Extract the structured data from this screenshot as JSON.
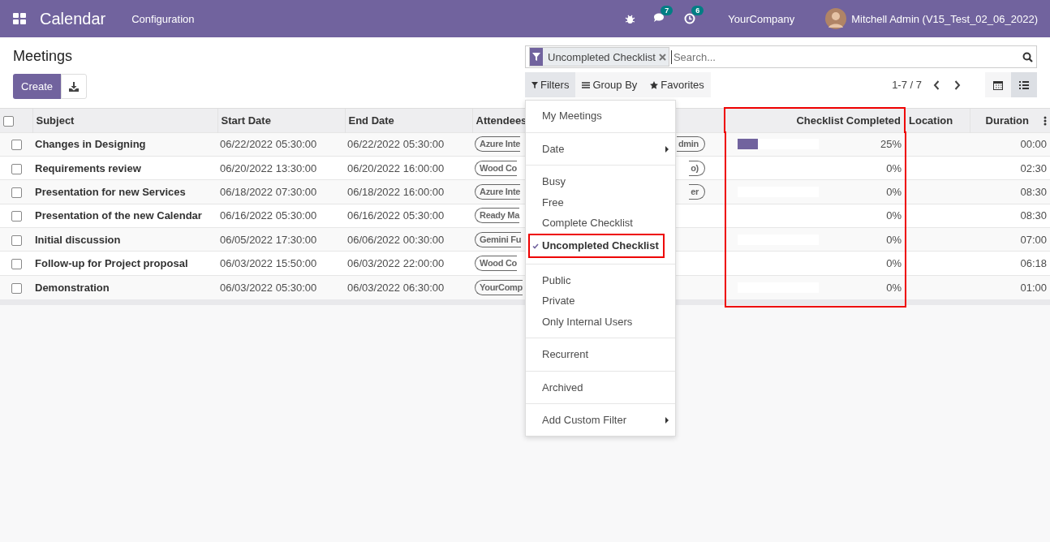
{
  "navbar": {
    "app_name": "Calendar",
    "menu": [
      "Configuration"
    ],
    "messages_count": "7",
    "activities_count": "6",
    "company": "YourCompany",
    "user": "Mitchell Admin (V15_Test_02_06_2022)"
  },
  "breadcrumb": "Meetings",
  "create_button": "Create",
  "search": {
    "facet": "Uncompleted Checklist",
    "placeholder": "Search..."
  },
  "search_panel": [
    {
      "kind": "filter",
      "label": "Filters",
      "selected": true
    },
    {
      "kind": "group",
      "label": "Group By",
      "selected": false
    },
    {
      "kind": "star",
      "label": "Favorites",
      "selected": false
    }
  ],
  "pager": "1-7 / 7",
  "views": [
    {
      "kind": "calendar",
      "selected": false
    },
    {
      "kind": "list",
      "selected": true
    }
  ],
  "filters_menu": [
    [
      {
        "label": "My Meetings",
        "checked": false,
        "submenu": false
      }
    ],
    [
      {
        "label": "Date",
        "checked": false,
        "submenu": true
      }
    ],
    [
      {
        "label": "Busy",
        "checked": false,
        "submenu": false
      },
      {
        "label": "Free",
        "checked": false,
        "submenu": false
      },
      {
        "label": "Complete Checklist",
        "checked": false,
        "submenu": false
      },
      {
        "label": "Uncompleted Checklist",
        "checked": true,
        "submenu": false
      }
    ],
    [
      {
        "label": "Public",
        "checked": false,
        "submenu": false
      },
      {
        "label": "Private",
        "checked": false,
        "submenu": false
      },
      {
        "label": "Only Internal Users",
        "checked": false,
        "submenu": false
      }
    ],
    [
      {
        "label": "Recurrent",
        "checked": false,
        "submenu": false
      }
    ],
    [
      {
        "label": "Archived",
        "checked": false,
        "submenu": false
      }
    ],
    [
      {
        "label": "Add Custom Filter",
        "checked": false,
        "submenu": true
      }
    ]
  ],
  "table": {
    "all_selected": false,
    "columns": [
      {
        "label": "Subject",
        "highlighted": false
      },
      {
        "label": "Start Date",
        "highlighted": false
      },
      {
        "label": "End Date",
        "highlighted": false
      },
      {
        "label": "Attendees",
        "highlighted": false
      },
      {
        "label": "Checklist Completed",
        "highlighted": true
      },
      {
        "label": "Location",
        "highlighted": false
      },
      {
        "label": "Duration",
        "highlighted": false
      }
    ],
    "rows": [
      {
        "subject": "Changes in Designing",
        "start": "06/22/2022 05:30:00",
        "end": "06/22/2022 05:30:00",
        "attendee": "Azure Inte",
        "attendee_more": "dmin",
        "level": 0.25,
        "completed": "25%",
        "duration": "00:00",
        "checked": false
      },
      {
        "subject": "Requirements review",
        "start": "06/20/2022 13:30:00",
        "end": "06/20/2022 16:00:00",
        "attendee": "Wood Co",
        "attendee_more": "o)",
        "level": 0,
        "completed": "0%",
        "duration": "02:30",
        "checked": false
      },
      {
        "subject": "Presentation for new Services",
        "start": "06/18/2022 07:30:00",
        "end": "06/18/2022 16:00:00",
        "attendee": "Azure Inte",
        "attendee_more": "er",
        "level": 0,
        "completed": "0%",
        "duration": "08:30",
        "checked": false
      },
      {
        "subject": "Presentation of the new Calendar",
        "start": "06/16/2022 05:30:00",
        "end": "06/16/2022 05:30:00",
        "attendee": "Ready Ma",
        "level": 0,
        "completed": "0%",
        "duration": "08:30",
        "checked": false
      },
      {
        "subject": "Initial discussion",
        "start": "06/05/2022 17:30:00",
        "end": "06/06/2022 00:30:00",
        "attendee": "Gemini Fu",
        "level": 0,
        "completed": "0%",
        "duration": "07:00",
        "checked": false
      },
      {
        "subject": "Follow-up for Project proposal",
        "start": "06/03/2022 15:50:00",
        "end": "06/03/2022 22:00:00",
        "attendee": "Wood Co",
        "level": 0,
        "completed": "0%",
        "duration": "06:18",
        "checked": false
      },
      {
        "subject": "Demonstration",
        "start": "06/03/2022 05:30:00",
        "end": "06/03/2022 06:30:00",
        "attendee": "YourComp",
        "level": 0,
        "completed": "0%",
        "duration": "01:00",
        "checked": false
      }
    ]
  }
}
